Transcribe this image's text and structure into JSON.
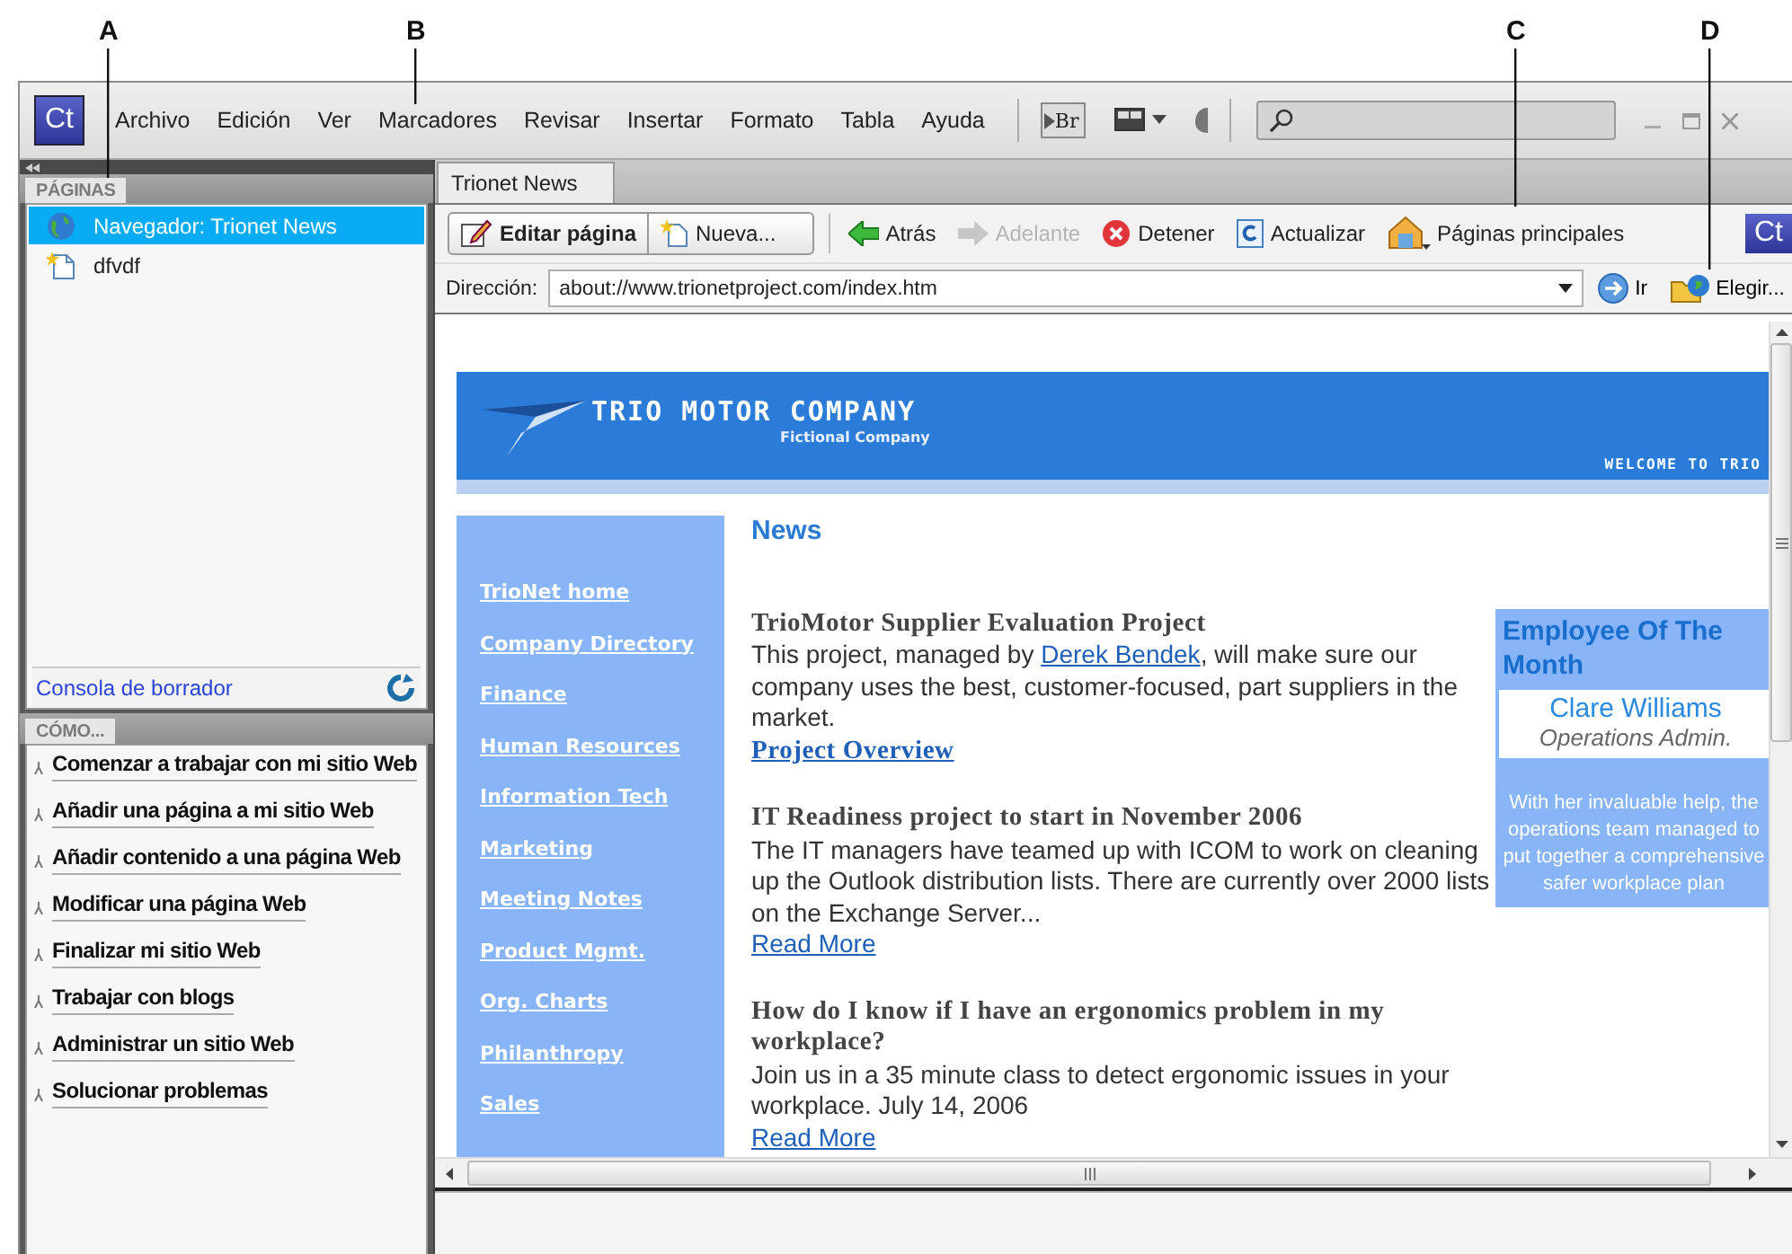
{
  "callouts": [
    {
      "label": "A"
    },
    {
      "label": "B"
    },
    {
      "label": "C"
    },
    {
      "label": "D"
    }
  ],
  "menubar": {
    "logo": "Ct",
    "items": [
      "Archivo",
      "Edición",
      "Ver",
      "Marcadores",
      "Revisar",
      "Insertar",
      "Formato",
      "Tabla",
      "Ayuda"
    ],
    "bridge": "Br"
  },
  "pages_panel": {
    "tab": "PÁGINAS",
    "items": [
      {
        "label": "Navegador: Trionet News",
        "kind": "browser",
        "selected": true
      },
      {
        "label": "dfvdf",
        "kind": "page",
        "selected": false
      }
    ],
    "footer_link": "Consola de borrador"
  },
  "howto_panel": {
    "tab": "CÓMO...",
    "items": [
      "Comenzar a trabajar con mi sitio Web",
      "Añadir una página a mi sitio Web",
      "Añadir contenido a una página Web",
      "Modificar una página Web",
      "Finalizar mi sitio Web",
      "Trabajar con blogs",
      "Administrar un sitio Web",
      "Solucionar problemas"
    ]
  },
  "document_tabs": [
    {
      "label": "Trionet News",
      "selected": true
    }
  ],
  "toolbar": {
    "buttons": [
      {
        "label": "Editar página",
        "kind": "edit",
        "disabled": false
      },
      {
        "label": "Nueva...",
        "kind": "new",
        "disabled": false
      },
      {
        "label": "Atrás",
        "kind": "back",
        "disabled": false
      },
      {
        "label": "Adelante",
        "kind": "forward",
        "disabled": true
      },
      {
        "label": "Detener",
        "kind": "stop",
        "disabled": false
      },
      {
        "label": "Actualizar",
        "kind": "refresh",
        "disabled": false
      },
      {
        "label": "Páginas principales",
        "kind": "home",
        "disabled": false
      }
    ],
    "logo": "Ct"
  },
  "address_bar": {
    "label": "Dirección:",
    "value": "about://www.trionetproject.com/index.htm",
    "go": "Ir",
    "choose": "Elegir..."
  },
  "web_page": {
    "banner": {
      "title": "TRIO MOTOR COMPANY",
      "subtitle": "Fictional Company",
      "welcome": "WELCOME TO TRIO"
    },
    "nav_links": [
      "TrioNet home",
      "Company Directory",
      "Finance",
      "Human Resources",
      "Information Tech",
      "Marketing",
      "Meeting Notes",
      "Product Mgmt.",
      "Org. Charts",
      "Philanthropy",
      "Sales"
    ],
    "heading": "News",
    "articles": [
      {
        "title": "TrioMotor Supplier Evaluation Project",
        "body": "This project, managed by ",
        "body_link": "Derek Bendek",
        "body_after": ", will make sure our company uses the best, customer-focused, part suppliers in the market.",
        "link": "Project Overview",
        "kind": "overview"
      },
      {
        "title": "IT Readiness project to start in November 2006",
        "body": "The IT managers have teamed up with ICOM to work on cleaning up the Outlook distribution lists. There are currently over 2000 lists on the Exchange Server...",
        "link": "Read More",
        "kind": "read_more"
      },
      {
        "title": "How do I know if I have an ergonomics problem in my workplace?",
        "body": "Join us in a 35 minute class to detect ergonomic issues in your workplace. July 14, 2006",
        "link": "Read More",
        "kind": "read_more"
      }
    ],
    "employee": {
      "heading": "Employee Of The Month",
      "name": "Clare Williams",
      "role": "Operations Admin.",
      "text": "With her invaluable help, the operations team managed to put together a comprehensive safer workplace plan"
    }
  }
}
